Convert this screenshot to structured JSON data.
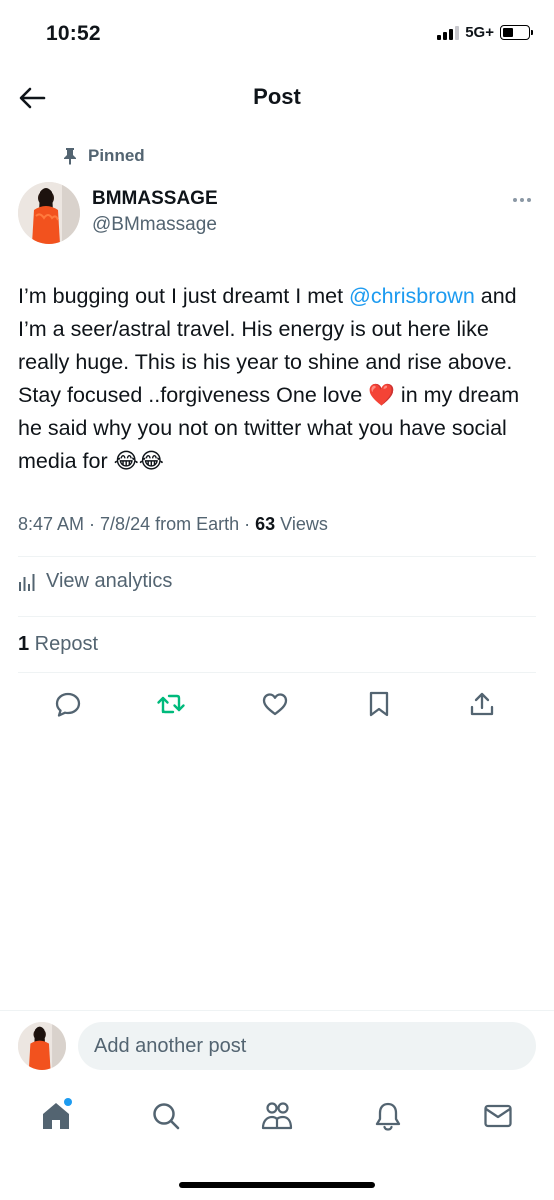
{
  "status_bar": {
    "time": "10:52",
    "network": "5G+",
    "battery_level": 0.4
  },
  "header": {
    "title": "Post",
    "back_icon": "arrow-left-icon"
  },
  "post": {
    "pinned_label": "Pinned",
    "author": {
      "name": "BMMASSAGE",
      "handle": "@BMmassage"
    },
    "text_parts": {
      "p1": "I’m bugging out I just dreamt I met ",
      "mention": "@chrisbrown",
      "p2": " and I’m a seer/astral travel. His energy is out here like really huge. This is his year to shine and rise above. Stay focused ..forgiveness One love ",
      "heart": "❤️",
      "p3": " in my dream he said why you not on twitter what you have social media for ",
      "emojis": "😂😂"
    },
    "meta": {
      "time": "8:47 AM",
      "sep1": " · ",
      "date": "7/8/24",
      "location": " from Earth",
      "sep2": " · ",
      "views_count": "63",
      "views_label": " Views"
    },
    "analytics_label": "View analytics",
    "reposts": {
      "count": "1",
      "label": " Repost"
    },
    "actions": [
      {
        "name": "reply",
        "icon": "reply-icon"
      },
      {
        "name": "repost",
        "icon": "repost-icon",
        "color": "#00ba7c"
      },
      {
        "name": "like",
        "icon": "heart-icon"
      },
      {
        "name": "bookmark",
        "icon": "bookmark-icon"
      },
      {
        "name": "share",
        "icon": "share-icon"
      }
    ]
  },
  "compose": {
    "placeholder": "Add another post"
  },
  "bottom_nav": [
    {
      "name": "home",
      "icon": "home-icon"
    },
    {
      "name": "search",
      "icon": "search-icon"
    },
    {
      "name": "communities",
      "icon": "people-icon"
    },
    {
      "name": "notifications",
      "icon": "bell-icon"
    },
    {
      "name": "messages",
      "icon": "mail-icon"
    }
  ],
  "colors": {
    "accent": "#1d9bf0",
    "text": "#0f1419",
    "muted": "#536471",
    "repost_green": "#00ba7c"
  }
}
